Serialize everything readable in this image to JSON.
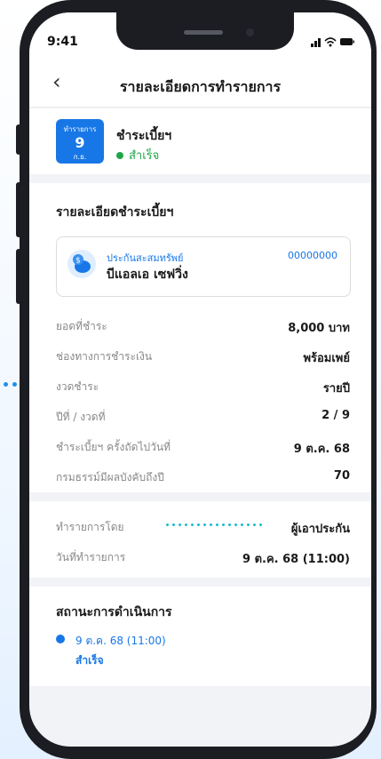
{
  "status_bar": {
    "time": "9:41"
  },
  "header": {
    "title": "รายละเอียดการทำรายการ"
  },
  "transaction": {
    "badge_label": "ทำรายการ",
    "badge_day": "9",
    "badge_month": "ก.ย.",
    "title": "ชำระเบี้ยฯ",
    "status": "สำเร็จ"
  },
  "payment_details": {
    "heading": "รายละเอียดชำระเบี้ยฯ",
    "policy": {
      "type": "ประกันสะสมทรัพย์",
      "number": "00000000",
      "name": "บีแอลเอ เซฟวิ่ง",
      "icon": "piggy-bank-icon"
    },
    "rows": [
      {
        "label": "ยอดที่ชำระ",
        "value": "8,000 บาท"
      },
      {
        "label": "ช่องทางการชำระเงิน",
        "value": "พร้อมเพย์"
      },
      {
        "label": "งวดชำระ",
        "value": "รายปี"
      },
      {
        "label": "ปีที่ / งวดที่",
        "value": "2 / 9"
      },
      {
        "label": "ชำระเบี้ยฯ ครั้งถัดไปวันที่",
        "value": "9 ต.ค. 68"
      },
      {
        "label": "กรมธรรม์มีผลบังคับถึงปี",
        "value": "70"
      }
    ]
  },
  "made_by": {
    "rows": [
      {
        "label": "ทำรายการโดย",
        "value": "ผู้เอาประกัน"
      },
      {
        "label": "วันที่ทำรายการ",
        "value": "9 ต.ค. 68 (11:00)"
      }
    ]
  },
  "progress": {
    "heading": "สถานะการดำเนินการ",
    "items": [
      {
        "date": "9 ต.ค. 68 (11:00)",
        "status": "สำเร็จ"
      }
    ]
  },
  "colors": {
    "accent": "#1877e6",
    "success": "#1fa64a",
    "dots": "#1bbcd0"
  }
}
